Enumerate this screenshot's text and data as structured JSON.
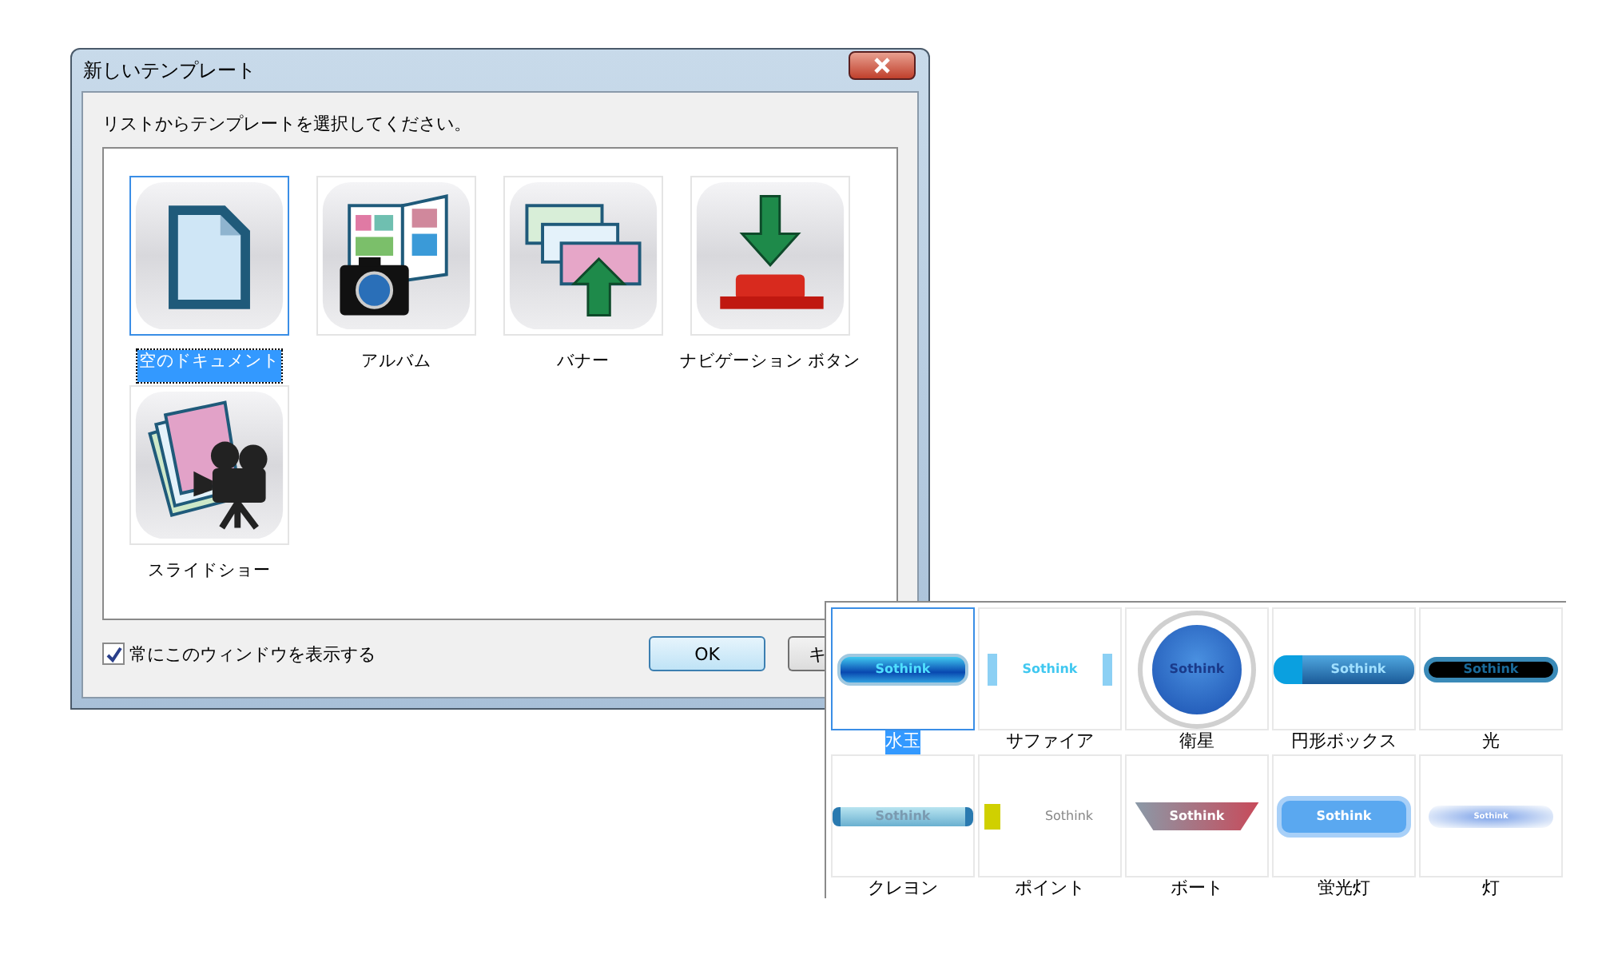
{
  "window": {
    "title": "新しいテンプレート"
  },
  "instruction": "リストからテンプレートを選択してください。",
  "templates": [
    {
      "label": "空のドキュメント",
      "kind": "document",
      "selected": true
    },
    {
      "label": "アルバム",
      "kind": "album",
      "selected": false
    },
    {
      "label": "バナー",
      "kind": "banner",
      "selected": false
    },
    {
      "label": "ナビゲーション ボタン",
      "kind": "navigation",
      "selected": false
    },
    {
      "label": "スライドショー",
      "kind": "slideshow",
      "selected": false
    }
  ],
  "show_always": {
    "label": "常にこのウィンドウを表示する",
    "checked": true
  },
  "buttons": [
    {
      "label": "OK",
      "kind": "default"
    },
    {
      "label": "キ",
      "kind": "normal"
    }
  ],
  "styles": [
    {
      "label": "水玉",
      "kind": "glossy",
      "preview_text": "Sothink",
      "selected": true
    },
    {
      "label": "サファイア",
      "kind": "sapphire",
      "preview_text": "Sothink",
      "selected": false
    },
    {
      "label": "衛星",
      "kind": "satellite",
      "preview_text": "Sothink",
      "selected": false
    },
    {
      "label": "円形ボックス",
      "kind": "circle-box",
      "preview_text": "Sothink",
      "selected": false
    },
    {
      "label": "光",
      "kind": "light",
      "preview_text": "Sothink",
      "selected": false
    },
    {
      "label": "クレヨン",
      "kind": "crayon",
      "preview_text": "Sothink",
      "selected": false
    },
    {
      "label": "ポイント",
      "kind": "point",
      "preview_text": "Sothink",
      "selected": false
    },
    {
      "label": "ボート",
      "kind": "boat",
      "preview_text": "Sothink",
      "selected": false
    },
    {
      "label": "蛍光灯",
      "kind": "fluorescent",
      "preview_text": "Sothink",
      "selected": false
    },
    {
      "label": "灯",
      "kind": "lamp",
      "preview_text": "Sothink",
      "selected": false
    }
  ]
}
